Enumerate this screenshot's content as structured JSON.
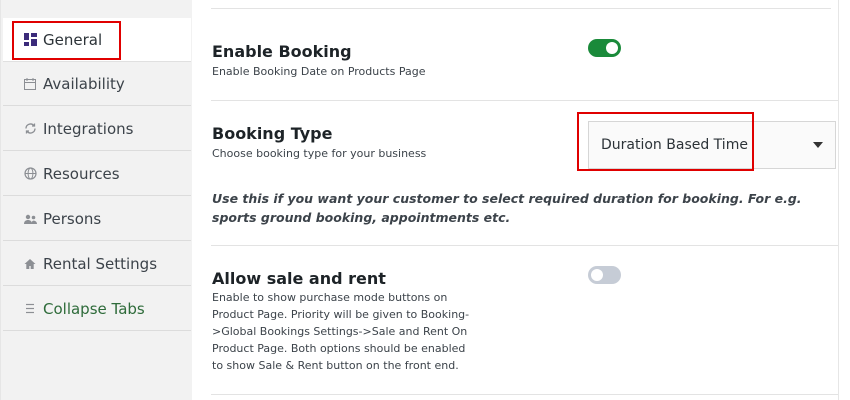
{
  "sidebar": {
    "items": [
      {
        "label": "General",
        "icon": "dashboard-grid-icon",
        "active": true
      },
      {
        "label": "Availability",
        "icon": "calendar-icon"
      },
      {
        "label": "Integrations",
        "icon": "sync-icon"
      },
      {
        "label": "Resources",
        "icon": "globe-icon"
      },
      {
        "label": "Persons",
        "icon": "people-icon"
      },
      {
        "label": "Rental Settings",
        "icon": "home-icon"
      },
      {
        "label": "Collapse Tabs",
        "icon": "menu-lines-icon"
      }
    ]
  },
  "settings": {
    "enable_booking": {
      "title": "Enable Booking",
      "description": "Enable Booking Date on Products Page",
      "enabled": true
    },
    "booking_type": {
      "title": "Booking Type",
      "description": "Choose booking type for your business",
      "selected": "Duration Based Time",
      "hint": "Use this if you want your customer to select required duration for booking. For e.g. sports ground booking, appointments etc."
    },
    "allow_sale_rent": {
      "title": "Allow sale and rent",
      "description_lines": [
        "Enable to show purchase mode buttons on",
        "Product Page. Priority will be given to Booking-",
        ">Global Bookings Settings->Sale and Rent On",
        "Product Page. Both options should be enabled",
        "to show Sale & Rent button on the front end."
      ],
      "enabled": false
    }
  },
  "colors": {
    "accent": "#1a8a3a",
    "highlight": "#e00000",
    "general_icon": "#3b2a7a"
  }
}
